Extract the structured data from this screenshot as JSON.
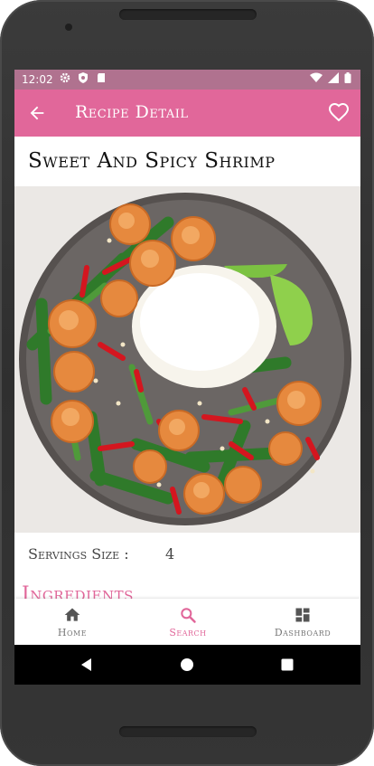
{
  "status_bar": {
    "time": "12:02",
    "left_icons": [
      "gear-icon",
      "shield-icon",
      "sd-card-icon"
    ],
    "right_icons": [
      "wifi-icon",
      "signal-icon",
      "battery-icon"
    ]
  },
  "app_bar": {
    "title": "Recipe Detail",
    "back_icon": "arrow-back-icon",
    "favorite_icon": "heart-outline-icon",
    "color": "#e1679a"
  },
  "recipe": {
    "name": "Sweet And Spicy Shrimp",
    "servings_label": "Servings Size :",
    "servings_value": "4",
    "ingredients_heading": "Ingredients"
  },
  "bottom_nav": {
    "items": [
      {
        "label": "Home",
        "icon": "home-icon",
        "active": false
      },
      {
        "label": "Search",
        "icon": "search-icon",
        "active": true
      },
      {
        "label": "Dashboard",
        "icon": "dashboard-icon",
        "active": false
      }
    ],
    "active_color": "#e1679a"
  },
  "system_nav": {
    "buttons": [
      "back-triangle-icon",
      "home-circle-icon",
      "recents-square-icon"
    ]
  }
}
